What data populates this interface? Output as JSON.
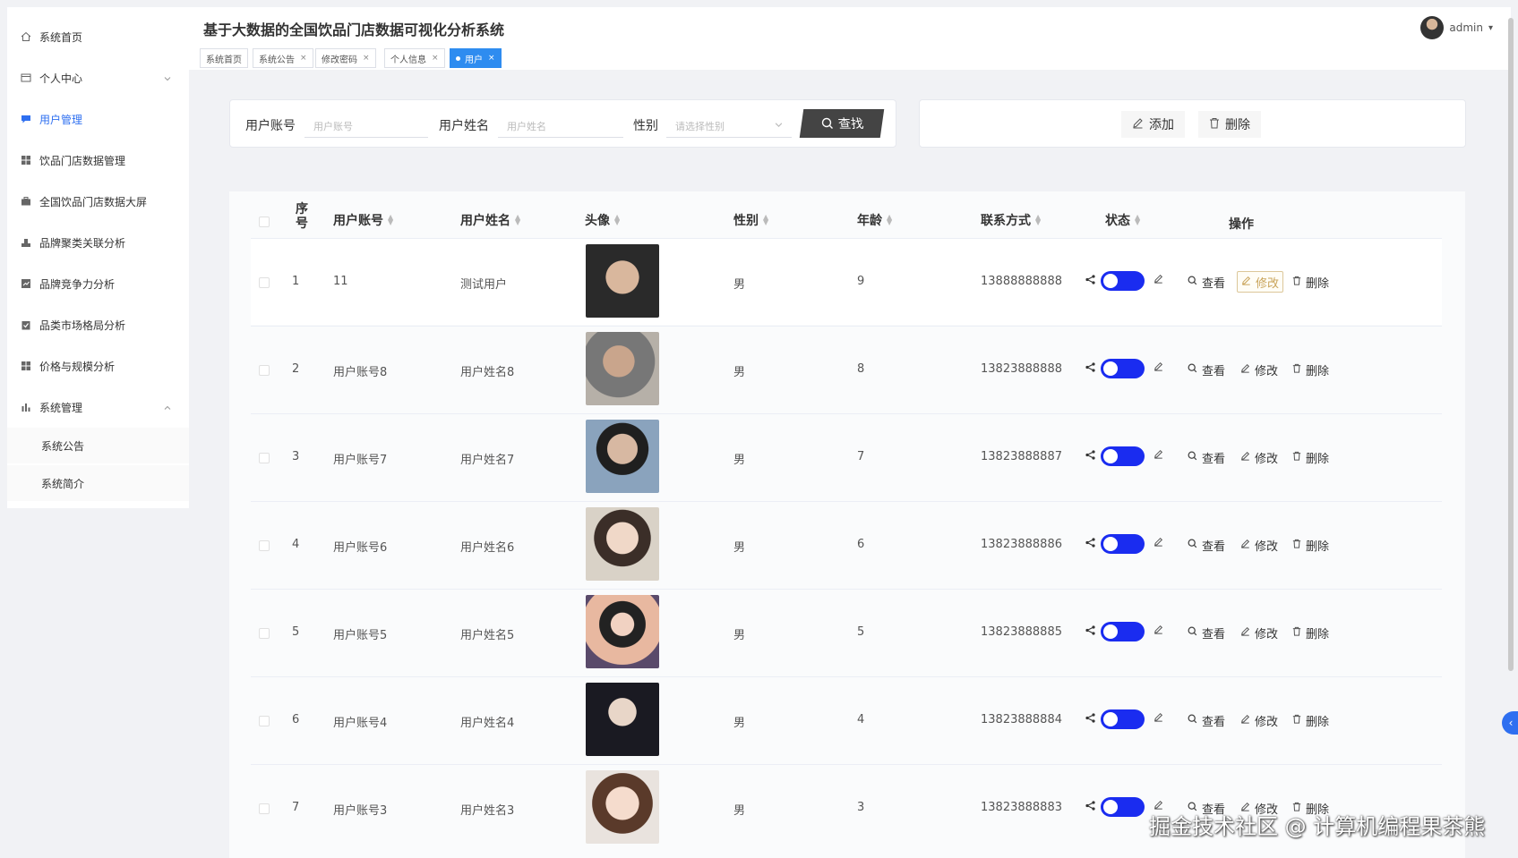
{
  "app_title": "基于大数据的全国饮品门店数据可视化分析系统",
  "sidebar": {
    "items": [
      {
        "label": "系统首页",
        "icon": "home-icon"
      },
      {
        "label": "个人中心",
        "icon": "window-icon"
      },
      {
        "label": "用户管理",
        "icon": "chat-icon"
      },
      {
        "label": "饮品门店数据管理",
        "icon": "grid-icon"
      },
      {
        "label": "全国饮品门店数据大屏",
        "icon": "briefcase-icon"
      },
      {
        "label": "品牌聚类关联分析",
        "icon": "stamp-icon"
      },
      {
        "label": "品牌竞争力分析",
        "icon": "chart-card-icon"
      },
      {
        "label": "品类市场格局分析",
        "icon": "clipboard-check-icon"
      },
      {
        "label": "价格与规模分析",
        "icon": "grid-icon"
      },
      {
        "label": "系统管理",
        "icon": "bar-chart-icon"
      }
    ],
    "sub_items": [
      "系统公告",
      "系统简介"
    ]
  },
  "tabs": [
    {
      "label": "系统首页"
    },
    {
      "label": "系统公告",
      "close": "×"
    },
    {
      "label": "修改密码",
      "close": "×"
    },
    {
      "label": "个人信息",
      "close": "×"
    },
    {
      "label": "用户",
      "close": "×"
    }
  ],
  "user": {
    "name": "admin",
    "caret": "▾"
  },
  "search": {
    "account_label": "用户账号",
    "account_placeholder": "用户账号",
    "name_label": "用户姓名",
    "name_placeholder": "用户姓名",
    "gender_label": "性别",
    "gender_placeholder": "请选择性别",
    "find_label": "查找"
  },
  "actions": {
    "add": "添加",
    "delete": "删除"
  },
  "table": {
    "headers": {
      "index": "序号",
      "account": "用户账号",
      "name": "用户姓名",
      "avatar": "头像",
      "gender": "性别",
      "age": "年龄",
      "contact": "联系方式",
      "status": "状态",
      "ops": "操作"
    },
    "op_labels": {
      "view": "查看",
      "edit": "修改",
      "delete": "删除"
    },
    "rows": [
      {
        "index": "1",
        "account": "11",
        "name": "测试用户",
        "gender": "男",
        "age": "9",
        "phone": "13888888888"
      },
      {
        "index": "2",
        "account": "用户账号8",
        "name": "用户姓名8",
        "gender": "男",
        "age": "8",
        "phone": "13823888888"
      },
      {
        "index": "3",
        "account": "用户账号7",
        "name": "用户姓名7",
        "gender": "男",
        "age": "7",
        "phone": "13823888887"
      },
      {
        "index": "4",
        "account": "用户账号6",
        "name": "用户姓名6",
        "gender": "男",
        "age": "6",
        "phone": "13823888886"
      },
      {
        "index": "5",
        "account": "用户账号5",
        "name": "用户姓名5",
        "gender": "男",
        "age": "5",
        "phone": "13823888885"
      },
      {
        "index": "6",
        "account": "用户账号4",
        "name": "用户姓名4",
        "gender": "男",
        "age": "4",
        "phone": "13823888884"
      },
      {
        "index": "7",
        "account": "用户账号3",
        "name": "用户姓名3",
        "gender": "男",
        "age": "3",
        "phone": "13823888883"
      }
    ]
  },
  "watermark": "掘金技术社区 @ 计算机编程果茶熊",
  "colors": {
    "accent": "#2e6ff0",
    "toggle": "#1a2cf0",
    "find_button": "#444444",
    "active_tab": "#2e8cf0"
  }
}
